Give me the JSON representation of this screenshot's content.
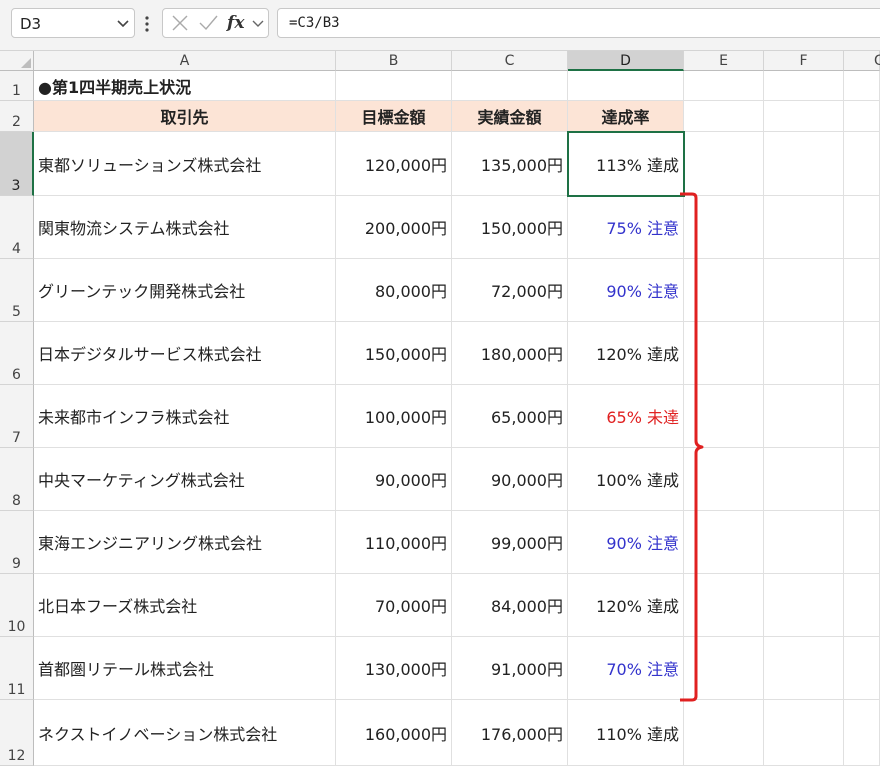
{
  "formula_bar": {
    "name_box": "D3",
    "fx_label": "fx",
    "formula": "=C3/B3"
  },
  "columns": [
    "A",
    "B",
    "C",
    "D",
    "E",
    "F",
    "G"
  ],
  "rows": [
    "1",
    "2",
    "3",
    "4",
    "5",
    "6",
    "7",
    "8",
    "9",
    "10",
    "11",
    "12"
  ],
  "sheet": {
    "title": "●第1四半期売上状況",
    "headers": [
      "取引先",
      "目標金額",
      "実績金額",
      "達成率"
    ],
    "records": [
      {
        "client": "東都ソリューションズ株式会社",
        "target": "120,000円",
        "actual": "135,000円",
        "rate": "113% 達成",
        "status": "ok"
      },
      {
        "client": "関東物流システム株式会社",
        "target": "200,000円",
        "actual": "150,000円",
        "rate": "75% 注意",
        "status": "warn"
      },
      {
        "client": "グリーンテック開発株式会社",
        "target": "80,000円",
        "actual": "72,000円",
        "rate": "90% 注意",
        "status": "warn"
      },
      {
        "client": "日本デジタルサービス株式会社",
        "target": "150,000円",
        "actual": "180,000円",
        "rate": "120% 達成",
        "status": "ok"
      },
      {
        "client": "未来都市インフラ株式会社",
        "target": "100,000円",
        "actual": "65,000円",
        "rate": "65% 未達",
        "status": "bad"
      },
      {
        "client": "中央マーケティング株式会社",
        "target": "90,000円",
        "actual": "90,000円",
        "rate": "100% 達成",
        "status": "ok"
      },
      {
        "client": "東海エンジニアリング株式会社",
        "target": "110,000円",
        "actual": "99,000円",
        "rate": "90% 注意",
        "status": "warn"
      },
      {
        "client": "北日本フーズ株式会社",
        "target": "70,000円",
        "actual": "84,000円",
        "rate": "120% 達成",
        "status": "ok"
      },
      {
        "client": "首都圏リテール株式会社",
        "target": "130,000円",
        "actual": "91,000円",
        "rate": "70% 注意",
        "status": "warn"
      },
      {
        "client": "ネクストイノベーション株式会社",
        "target": "160,000円",
        "actual": "176,000円",
        "rate": "110% 達成",
        "status": "ok"
      }
    ]
  },
  "selected": {
    "column": "D",
    "row": "3"
  },
  "colors": {
    "header_fill": "#fce4d6",
    "selection": "#1e7145",
    "warn": "#3333cc",
    "bad": "#e02020",
    "bracket": "#e02020"
  }
}
